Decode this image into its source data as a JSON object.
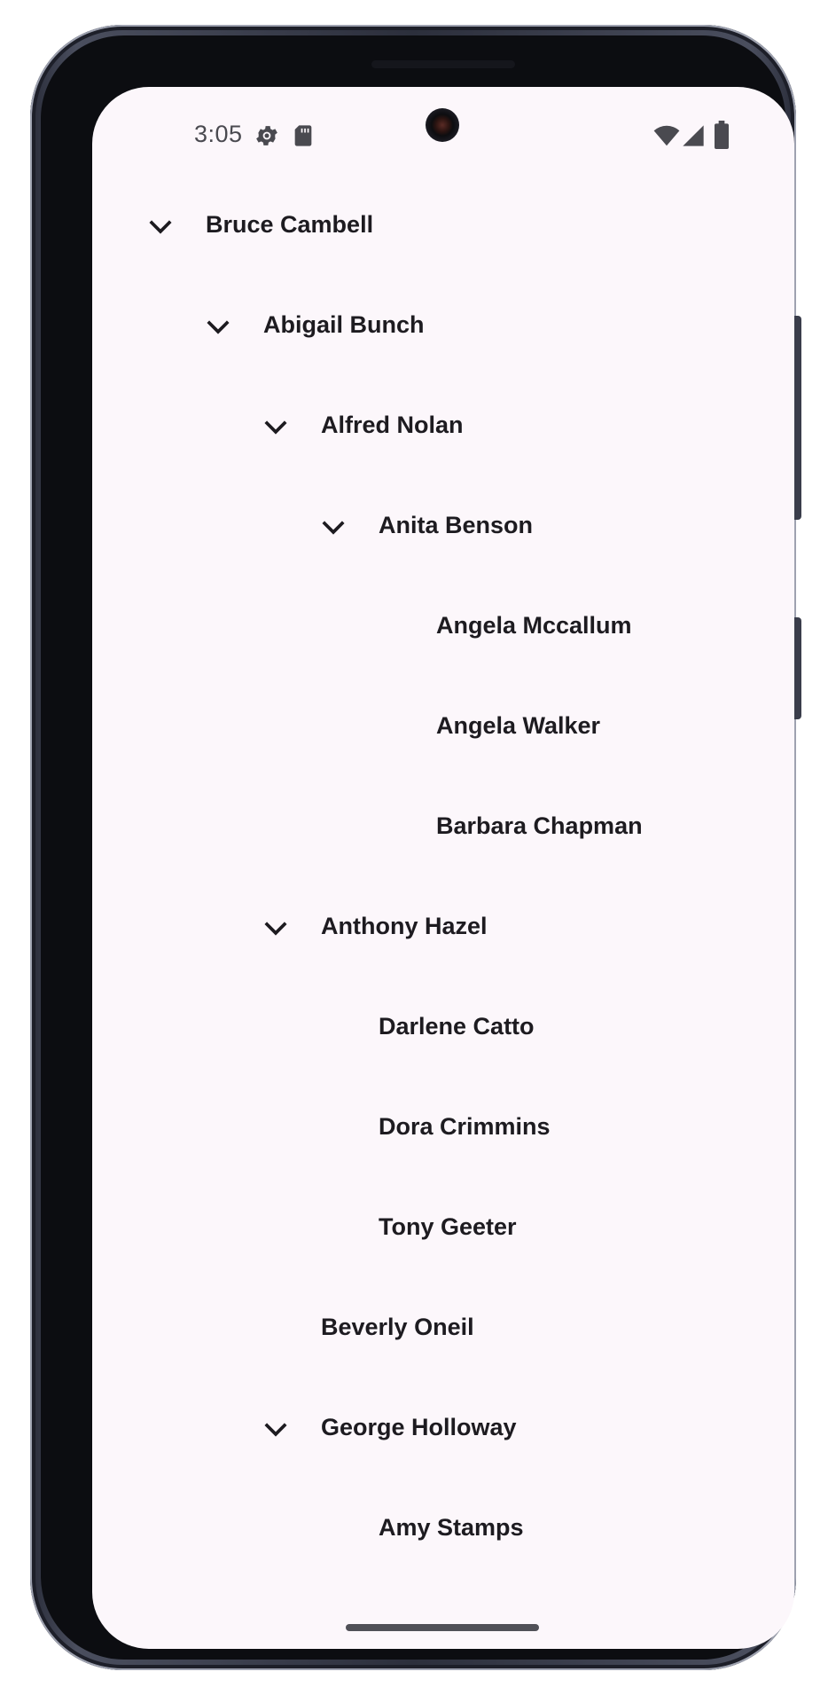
{
  "status_bar": {
    "time": "3:05",
    "icons": [
      "settings-gear-icon",
      "sd-card-icon",
      "wifi-icon",
      "cell-signal-icon",
      "battery-icon"
    ]
  },
  "tree": {
    "nodes": [
      {
        "label": "Bruce Cambell",
        "depth": 0,
        "expanded": true
      },
      {
        "label": "Abigail Bunch",
        "depth": 1,
        "expanded": true
      },
      {
        "label": "Alfred Nolan",
        "depth": 2,
        "expanded": true
      },
      {
        "label": "Anita Benson",
        "depth": 3,
        "expanded": true
      },
      {
        "label": "Angela Mccallum",
        "depth": 4,
        "expanded": null
      },
      {
        "label": "Angela Walker",
        "depth": 4,
        "expanded": null
      },
      {
        "label": "Barbara Chapman",
        "depth": 4,
        "expanded": null
      },
      {
        "label": "Anthony Hazel",
        "depth": 2,
        "expanded": true
      },
      {
        "label": "Darlene Catto",
        "depth": 3,
        "expanded": null
      },
      {
        "label": "Dora Crimmins",
        "depth": 3,
        "expanded": null
      },
      {
        "label": "Tony Geeter",
        "depth": 3,
        "expanded": null
      },
      {
        "label": "Beverly Oneil",
        "depth": 2,
        "expanded": null
      },
      {
        "label": "George Holloway",
        "depth": 2,
        "expanded": true
      },
      {
        "label": "Amy Stamps",
        "depth": 3,
        "expanded": null
      }
    ]
  },
  "colors": {
    "screen_background": "#fcf7fb",
    "text": "#1d1b20",
    "status_text": "#4a4a50"
  }
}
